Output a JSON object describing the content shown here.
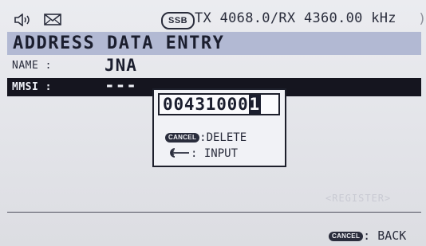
{
  "status_bar": {
    "speaker_icon": "speaker-icon",
    "mail_icon": "mail-icon",
    "mode": "SSB",
    "frequency": "TX 4068.0/RX 4360.00 kHz"
  },
  "title": "ADDRESS DATA ENTRY",
  "fields": {
    "name_label": "NAME :",
    "name_value": "JNA",
    "mmsi_label": "MMSI :",
    "mmsi_value": "---"
  },
  "popup": {
    "entry_digits": "00431000",
    "cursor_digit": "1",
    "cancel_key": "CANCEL",
    "delete_label": ":DELETE",
    "enter_icon": "enter-key-icon",
    "input_label": ": INPUT"
  },
  "register_label": "<REGISTER>",
  "footer": {
    "cancel_key": "CANCEL",
    "back_label": ": BACK"
  },
  "colors": {
    "title_bar": "#b2b9d3",
    "selected_row": "#15151f",
    "screen_bg": "#e6e7ec"
  }
}
